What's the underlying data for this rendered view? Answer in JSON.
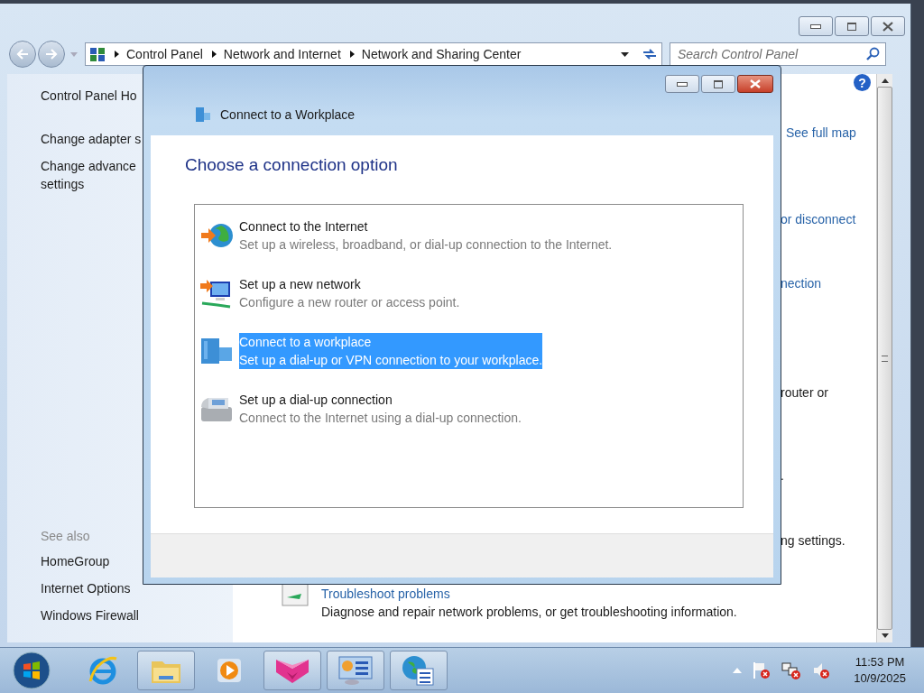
{
  "window": {
    "breadcrumb": [
      "Control Panel",
      "Network and Internet",
      "Network and Sharing Center"
    ],
    "search": {
      "placeholder": "Search Control Panel"
    },
    "help": "?"
  },
  "sidebar": {
    "links": [
      "Control Panel Ho",
      "Change adapter s",
      "Change advance\nsettings"
    ],
    "see_also_heading": "See also",
    "see_also": [
      "HomeGroup",
      "Internet Options",
      "Windows Firewall"
    ]
  },
  "content": {
    "fragments": [
      {
        "text": "See full map",
        "kind": "link"
      },
      {
        "text": "or disconnect",
        "kind": "link"
      },
      {
        "text": "nection",
        "kind": "link"
      },
      {
        "text": "router or",
        "kind": "text"
      },
      {
        "text": ".",
        "kind": "text"
      },
      {
        "text": "ng settings.",
        "kind": "text"
      }
    ],
    "troubleshoot": {
      "title": "Troubleshoot problems",
      "description": "Diagnose and repair network problems, or get troubleshooting information."
    }
  },
  "dialog": {
    "title": "Connect to a Workplace",
    "heading": "Choose a connection option",
    "options": [
      {
        "title": "Connect to the Internet",
        "description": "Set up a wireless, broadband, or dial-up connection to the Internet.",
        "selected": false
      },
      {
        "title": "Set up a new network",
        "description": "Configure a new router or access point.",
        "selected": false
      },
      {
        "title": "Connect to a workplace",
        "description": "Set up a dial-up or VPN connection to your workplace.",
        "selected": true
      },
      {
        "title": "Set up a dial-up connection",
        "description": "Connect to the Internet using a dial-up connection.",
        "selected": false
      }
    ]
  },
  "taskbar": {
    "apps": [
      {
        "kind": "browser",
        "open": false
      },
      {
        "kind": "folder",
        "open": true
      },
      {
        "kind": "player",
        "open": false
      },
      {
        "kind": "cube",
        "open": true
      },
      {
        "kind": "panel",
        "open": true
      },
      {
        "kind": "globe",
        "open": true
      }
    ],
    "time": "11:53 PM",
    "date": "10/9/2025"
  }
}
